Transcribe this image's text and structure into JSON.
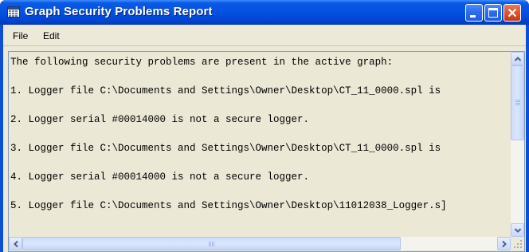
{
  "window": {
    "title": "Graph Security Problems Report",
    "title_icon": "table-icon"
  },
  "menu": {
    "items": [
      "File",
      "Edit"
    ]
  },
  "report": {
    "lines": [
      "The following security problems are present in the active graph:",
      "1. Logger file C:\\Documents and Settings\\Owner\\Desktop\\CT_11_0000.spl is",
      "2. Logger serial #00014000 is not a secure logger.",
      "3. Logger file C:\\Documents and Settings\\Owner\\Desktop\\CT_11_0000.spl is",
      "4. Logger serial #00014000 is not a secure logger.",
      "5. Logger file C:\\Documents and Settings\\Owner\\Desktop\\11012038_Logger.s]"
    ]
  },
  "colors": {
    "titlebar": "#0452df",
    "close_button": "#dc5634",
    "client_background": "#ece9d8"
  }
}
